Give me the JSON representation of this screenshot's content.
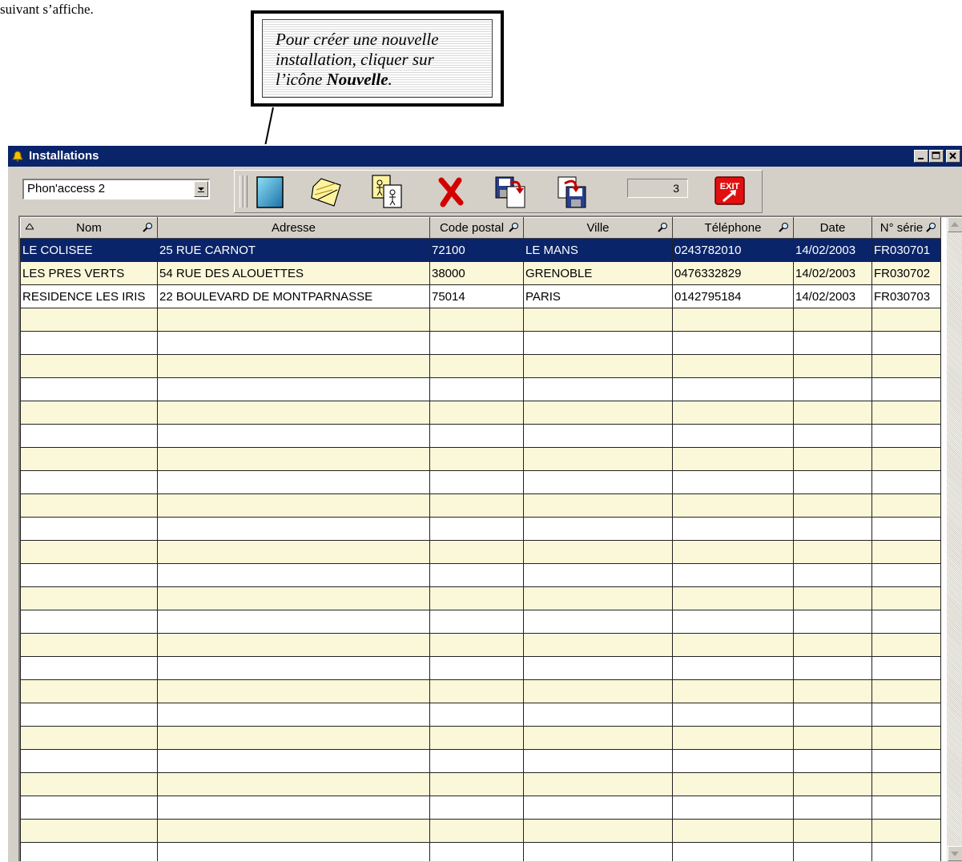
{
  "document": {
    "intro_text": "suivant s’affiche.",
    "callout_line1": "Pour créer une nouvelle",
    "callout_line2": "installation, cliquer sur",
    "callout_line3_prefix": "l’icône ",
    "callout_line3_bold": "Nouvelle",
    "callout_line3_suffix": "."
  },
  "window": {
    "title": "Installations",
    "controls": [
      "minimize",
      "maximize",
      "close"
    ],
    "title_bar_color": "#0a246a"
  },
  "toolbar": {
    "product_select": "Phon'access 2",
    "record_count": "3",
    "buttons": [
      {
        "name": "new-installation-button",
        "icon": "blank-page-icon",
        "label": "Nouvelle"
      },
      {
        "name": "open-button",
        "icon": "open-folder-icon"
      },
      {
        "name": "users-button",
        "icon": "persons-document-icon"
      },
      {
        "name": "delete-button",
        "icon": "red-x-icon"
      },
      {
        "name": "export-button",
        "icon": "floppy-export-icon"
      },
      {
        "name": "import-button",
        "icon": "floppy-import-icon"
      },
      {
        "name": "exit-button",
        "icon": "exit-icon",
        "label": "EXIT"
      }
    ]
  },
  "table": {
    "columns": [
      "Nom",
      "Adresse",
      "Code postal",
      "Ville",
      "Téléphone",
      "Date",
      "N° série"
    ],
    "rows": [
      [
        "LE COLISEE",
        "25 RUE CARNOT",
        "72100",
        "LE MANS",
        "0243782010",
        "14/02/2003",
        "FR030701"
      ],
      [
        "LES PRES VERTS",
        "54 RUE DES ALOUETTES",
        "38000",
        "GRENOBLE",
        "0476332829",
        "14/02/2003",
        "FR030702"
      ],
      [
        "RESIDENCE LES IRIS",
        "22 BOULEVARD DE MONTPARNASSE",
        "75014",
        "PARIS",
        "0142795184",
        "14/02/2003",
        "FR030703"
      ]
    ],
    "selected_row": 0,
    "row_colors": {
      "odd": "#fbf7d9",
      "even": "#ffffff",
      "selected": "#0a246a"
    }
  }
}
